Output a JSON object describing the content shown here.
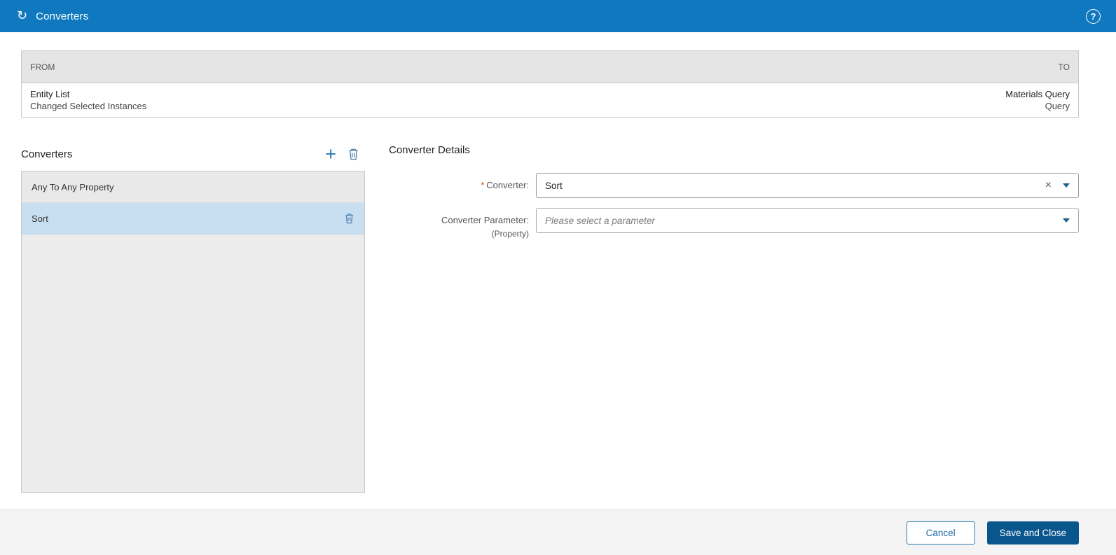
{
  "header": {
    "title": "Converters",
    "icon_glyph": "↻",
    "help_glyph": "?"
  },
  "mapping_table": {
    "from_header": "FROM",
    "to_header": "TO",
    "row": {
      "from_primary": "Entity List",
      "from_secondary": "Changed Selected Instances",
      "to_primary": "Materials Query",
      "to_secondary": "Query"
    }
  },
  "converters_panel": {
    "title": "Converters",
    "add_glyph": "+",
    "items": [
      {
        "label": "Any To Any Property",
        "selected": false
      },
      {
        "label": "Sort",
        "selected": true
      }
    ],
    "selected_index": 1
  },
  "details_panel": {
    "title": "Converter Details",
    "required_marker": "*",
    "converter_field": {
      "label": "Converter:",
      "value": "Sort",
      "clear_glyph": "×"
    },
    "parameter_field": {
      "label": "Converter Parameter:",
      "sublabel": "(Property)",
      "placeholder": "Please select a parameter"
    }
  },
  "footer": {
    "cancel_label": "Cancel",
    "save_label": "Save and Close"
  },
  "colors": {
    "header_bg": "#0f78be",
    "accent_blue": "#2a79b0",
    "selected_item_bg": "#c8dff1",
    "save_button_bg": "#09568d",
    "required_marker": "#c55a11"
  }
}
